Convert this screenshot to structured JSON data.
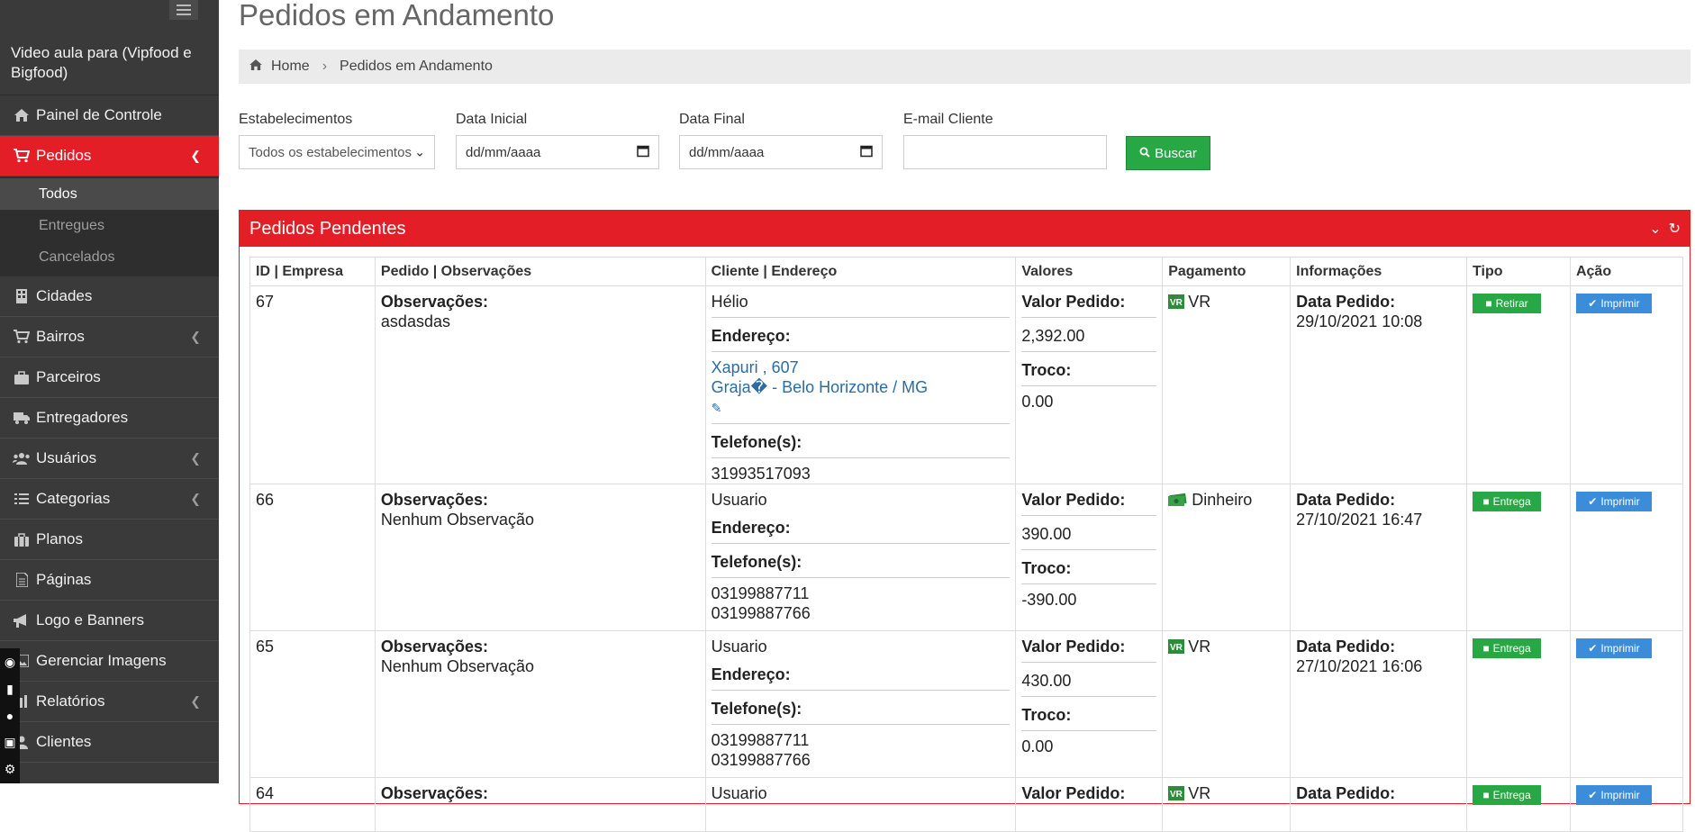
{
  "sidebar": {
    "profile": "Video aula para (Vipfood e Bigfood)",
    "items": [
      {
        "label": "Painel de Controle",
        "icon": "home-icon"
      },
      {
        "label": "Pedidos",
        "icon": "cart-icon"
      },
      {
        "label": "Cidades",
        "icon": "building-icon"
      },
      {
        "label": "Bairros",
        "icon": "cart-icon"
      },
      {
        "label": "Parceiros",
        "icon": "briefcase-icon"
      },
      {
        "label": "Entregadores",
        "icon": "truck-icon"
      },
      {
        "label": "Usuários",
        "icon": "users-icon"
      },
      {
        "label": "Categorias",
        "icon": "list-icon"
      },
      {
        "label": "Planos",
        "icon": "suitcase-icon"
      },
      {
        "label": "Páginas",
        "icon": "file-icon"
      },
      {
        "label": "Logo e Banners",
        "icon": "bullhorn-icon"
      },
      {
        "label": "Gerenciar Imagens",
        "icon": "image-icon"
      },
      {
        "label": "Relatórios",
        "icon": "chart-icon"
      },
      {
        "label": "Clientes",
        "icon": "user-icon"
      }
    ],
    "submenu": [
      "Todos",
      "Entregues",
      "Cancelados"
    ]
  },
  "page": {
    "title": "Pedidos em Andamento",
    "breadcrumb": {
      "home": "Home",
      "current": "Pedidos em Andamento"
    }
  },
  "filters": {
    "estab_label": "Estabelecimentos",
    "estab_value": "Todos os estabelecimentos",
    "data_inicial_label": "Data Inicial",
    "data_inicial_placeholder": "dd/mm/aaaa",
    "data_final_label": "Data Final",
    "data_final_placeholder": "dd/mm/aaaa",
    "email_label": "E-mail Cliente",
    "email_value": "",
    "search_button": "Buscar"
  },
  "panel": {
    "title": "Pedidos Pendentes",
    "columns": [
      "ID | Empresa",
      "Pedido | Observações",
      "Cliente | Endereço",
      "Valores",
      "Pagamento",
      "Informações",
      "Tipo",
      "Ação"
    ],
    "labels": {
      "observacoes": "Observações:",
      "endereco": "Endereço:",
      "telefones": "Telefone(s):",
      "valor_pedido": "Valor Pedido:",
      "troco": "Troco:",
      "data_pedido": "Data Pedido:",
      "imprimir": "Imprimir"
    },
    "rows": [
      {
        "id": "67",
        "obs": "asdasdas",
        "cliente": "Hélio",
        "endereco_l1": "Xapuri , 607",
        "endereco_l2": "Graja� - Belo Horizonte / MG",
        "telefone_l1": "31993517093",
        "telefone_l2": "",
        "valor": "2,392.00",
        "troco": "0.00",
        "pagamento": "VR",
        "pagamento_icon": "vr-icon",
        "data": "29/10/2021 10:08",
        "tipo": "Retirar"
      },
      {
        "id": "66",
        "obs": "Nenhum Observação",
        "cliente": "Usuario",
        "endereco_l1": "",
        "endereco_l2": "",
        "telefone_l1": "03199887711",
        "telefone_l2": "03199887766",
        "valor": "390.00",
        "troco": "-390.00",
        "pagamento": "Dinheiro",
        "pagamento_icon": "cash-icon",
        "data": "27/10/2021 16:47",
        "tipo": "Entrega"
      },
      {
        "id": "65",
        "obs": "Nenhum Observação",
        "cliente": "Usuario",
        "endereco_l1": "",
        "endereco_l2": "",
        "telefone_l1": "03199887711",
        "telefone_l2": "03199887766",
        "valor": "430.00",
        "troco": "0.00",
        "pagamento": "VR",
        "pagamento_icon": "vr-icon",
        "data": "27/10/2021 16:06",
        "tipo": "Entrega"
      },
      {
        "id": "64",
        "obs": "",
        "cliente": "Usuario",
        "valor": "",
        "pagamento": "VR",
        "pagamento_icon": "vr-icon",
        "data": "",
        "tipo": "Entrega"
      }
    ]
  },
  "colors": {
    "accent": "#e41e26",
    "sidebar": "#3a3a3a",
    "success": "#28a745",
    "primary": "#3b8dd9",
    "link": "#2b6ca3"
  }
}
